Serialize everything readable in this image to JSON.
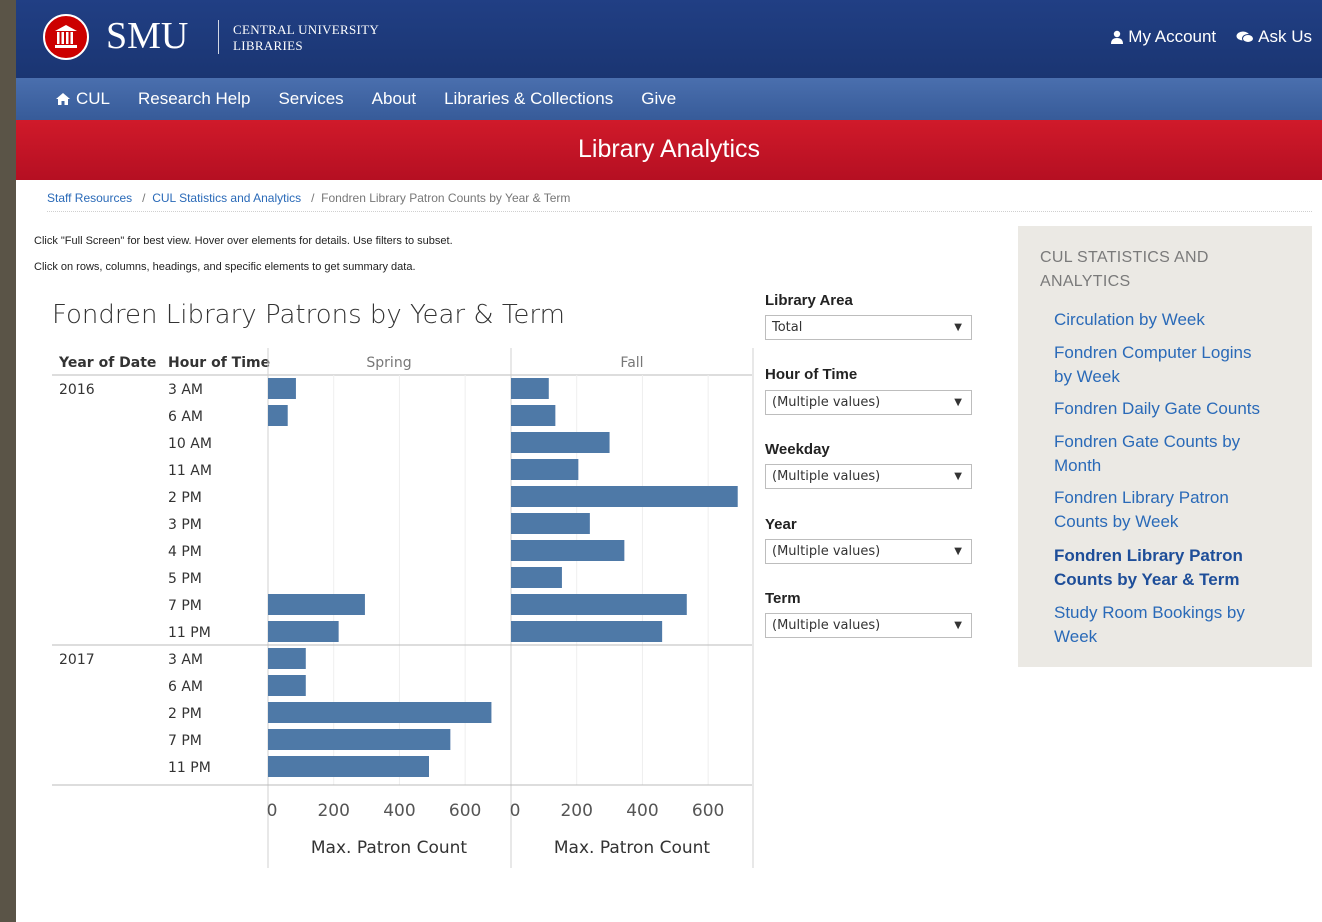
{
  "header": {
    "logo_text": "SMU",
    "logo_sub1": "CENTRAL UNIVERSITY",
    "logo_sub2": "LIBRARIES",
    "my_account": "My Account",
    "ask_us": "Ask Us"
  },
  "nav": {
    "items": [
      "CUL",
      "Research Help",
      "Services",
      "About",
      "Libraries & Collections",
      "Give"
    ]
  },
  "banner": {
    "title": "Library Analytics"
  },
  "breadcrumb": {
    "items": [
      "Staff Resources",
      "CUL Statistics and Analytics"
    ],
    "current": "Fondren Library Patron Counts by Year & Term",
    "separator": "/"
  },
  "instructions": {
    "line1": "Click \"Full Screen\" for best view. Hover over elements for details. Use filters to subset.",
    "line2": "Click on rows, columns, headings, and specific elements to get summary data."
  },
  "filters": [
    {
      "label": "Library Area",
      "value": "Total"
    },
    {
      "label": "Hour of Time",
      "value": "(Multiple values)"
    },
    {
      "label": "Weekday",
      "value": "(Multiple values)"
    },
    {
      "label": "Year",
      "value": "(Multiple values)"
    },
    {
      "label": "Term",
      "value": "(Multiple values)"
    }
  ],
  "sidebar": {
    "title_line1": "CUL STATISTICS AND",
    "title_line2": "ANALYTICS",
    "links": [
      {
        "lines": [
          "Circulation by Week"
        ],
        "active": false
      },
      {
        "lines": [
          "Fondren Computer Logins",
          "by Week"
        ],
        "active": false
      },
      {
        "lines": [
          "Fondren Daily Gate Counts"
        ],
        "active": false
      },
      {
        "lines": [
          "Fondren Gate Counts by",
          "Month"
        ],
        "active": false
      },
      {
        "lines": [
          "Fondren Library Patron",
          "Counts by Week"
        ],
        "active": false
      },
      {
        "lines": [
          "Fondren Library Patron",
          "Counts by Year & Term"
        ],
        "active": true
      },
      {
        "lines": [
          "Study Room Bookings by",
          "Week"
        ],
        "active": false
      }
    ]
  },
  "colors": {
    "bar": "#4e79a7",
    "nav": "#3f64a4",
    "topbar": "#1e3a7b",
    "banner": "#c8102e",
    "link": "#2a6ab8"
  },
  "chart_data": {
    "type": "bar",
    "title": "Fondren Library Patrons by Year & Term",
    "row_headers": [
      "Year of Date",
      "Hour of Time"
    ],
    "columns": [
      "Spring",
      "Fall"
    ],
    "xlabel": "Max. Patron Count",
    "xticks": [
      0,
      200,
      400,
      600
    ],
    "xlim": [
      0,
      700
    ],
    "groups": [
      {
        "year": "2016",
        "rows": [
          {
            "hour": "3 AM",
            "Spring": 85,
            "Fall": 115
          },
          {
            "hour": "6 AM",
            "Spring": 60,
            "Fall": 135
          },
          {
            "hour": "10 AM",
            "Spring": null,
            "Fall": 300
          },
          {
            "hour": "11 AM",
            "Spring": null,
            "Fall": 205
          },
          {
            "hour": "2 PM",
            "Spring": null,
            "Fall": 690
          },
          {
            "hour": "3 PM",
            "Spring": null,
            "Fall": 240
          },
          {
            "hour": "4 PM",
            "Spring": null,
            "Fall": 345
          },
          {
            "hour": "5 PM",
            "Spring": null,
            "Fall": 155
          },
          {
            "hour": "7 PM",
            "Spring": 295,
            "Fall": 535
          },
          {
            "hour": "11 PM",
            "Spring": 215,
            "Fall": 460
          }
        ]
      },
      {
        "year": "2017",
        "rows": [
          {
            "hour": "3 AM",
            "Spring": 115,
            "Fall": null
          },
          {
            "hour": "6 AM",
            "Spring": 115,
            "Fall": null
          },
          {
            "hour": "2 PM",
            "Spring": 680,
            "Fall": null
          },
          {
            "hour": "7 PM",
            "Spring": 555,
            "Fall": null
          },
          {
            "hour": "11 PM",
            "Spring": 490,
            "Fall": null
          }
        ]
      }
    ]
  }
}
